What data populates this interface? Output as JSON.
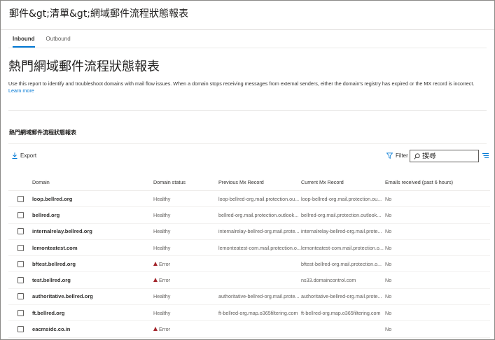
{
  "breadcrumb": "郵件&gt;清單&gt;網域郵件流程狀態報表",
  "tabs": [
    {
      "label": "Inbound",
      "active": true
    },
    {
      "label": "Outbound",
      "active": false
    }
  ],
  "page_title": "熱門網域郵件流程狀態報表",
  "description": "Use this report to identify and troubleshoot domains with mail flow issues. When a domain stops receiving messages from external senders, either the domain's registry has expired or the MX record is incorrect.",
  "learn_more": "Learn more",
  "section_title": "熱門網域郵件流程狀態報表",
  "toolbar": {
    "export_label": "Export",
    "filter_label": "Filter",
    "search_placeholder": "搜尋"
  },
  "columns": [
    "Domain",
    "Domain status",
    "Previous Mx Record",
    "Current Mx Record",
    "Emails received (past 6 hours)"
  ],
  "rows": [
    {
      "domain": "loop.bellred.org",
      "status": "Healthy",
      "prev": "loop-bellred-org.mail.protection.ou...",
      "curr": "loop-bellred-org.mail.protection.ou...",
      "emails": "No"
    },
    {
      "domain": "bellred.org",
      "status": "Healthy",
      "prev": "bellred-org.mail.protection.outlook...",
      "curr": "bellred-org.mail.protection.outlook...",
      "emails": "No"
    },
    {
      "domain": "internalrelay.bellred.org",
      "status": "Healthy",
      "prev": "internalrelay-bellred-org.mail.prote...",
      "curr": "internalrelay-bellred-org.mail.prote...",
      "emails": "No"
    },
    {
      "domain": "lemonteatest.com",
      "status": "Healthy",
      "prev": "lemonteatest-com.mail.protection.o...",
      "curr": "lemonteatest-com.mail.protection.o...",
      "emails": "No"
    },
    {
      "domain": "bftest.bellred.org",
      "status": "Error",
      "prev": "",
      "curr": "bftest-bellred-org.mail.protection.o...",
      "emails": "No"
    },
    {
      "domain": "test.bellred.org",
      "status": "Error",
      "prev": "",
      "curr": "ns33.domaincontrol.com",
      "emails": "No"
    },
    {
      "domain": "authoritative.bellred.org",
      "status": "Healthy",
      "prev": "authoritative-bellred-org.mail.prote...",
      "curr": "authoritative-bellred-org.mail.prote...",
      "emails": "No"
    },
    {
      "domain": "ft.bellred.org",
      "status": "Healthy",
      "prev": "ft-bellred-org.map.o365filtering.com",
      "curr": "ft-bellred-org.map.o365filtering.com",
      "emails": "No"
    },
    {
      "domain": "eacmsidc.co.in",
      "status": "Error",
      "prev": "",
      "curr": "",
      "emails": "No"
    }
  ],
  "colors": {
    "accent": "#0078d4",
    "error": "#a4262c"
  }
}
